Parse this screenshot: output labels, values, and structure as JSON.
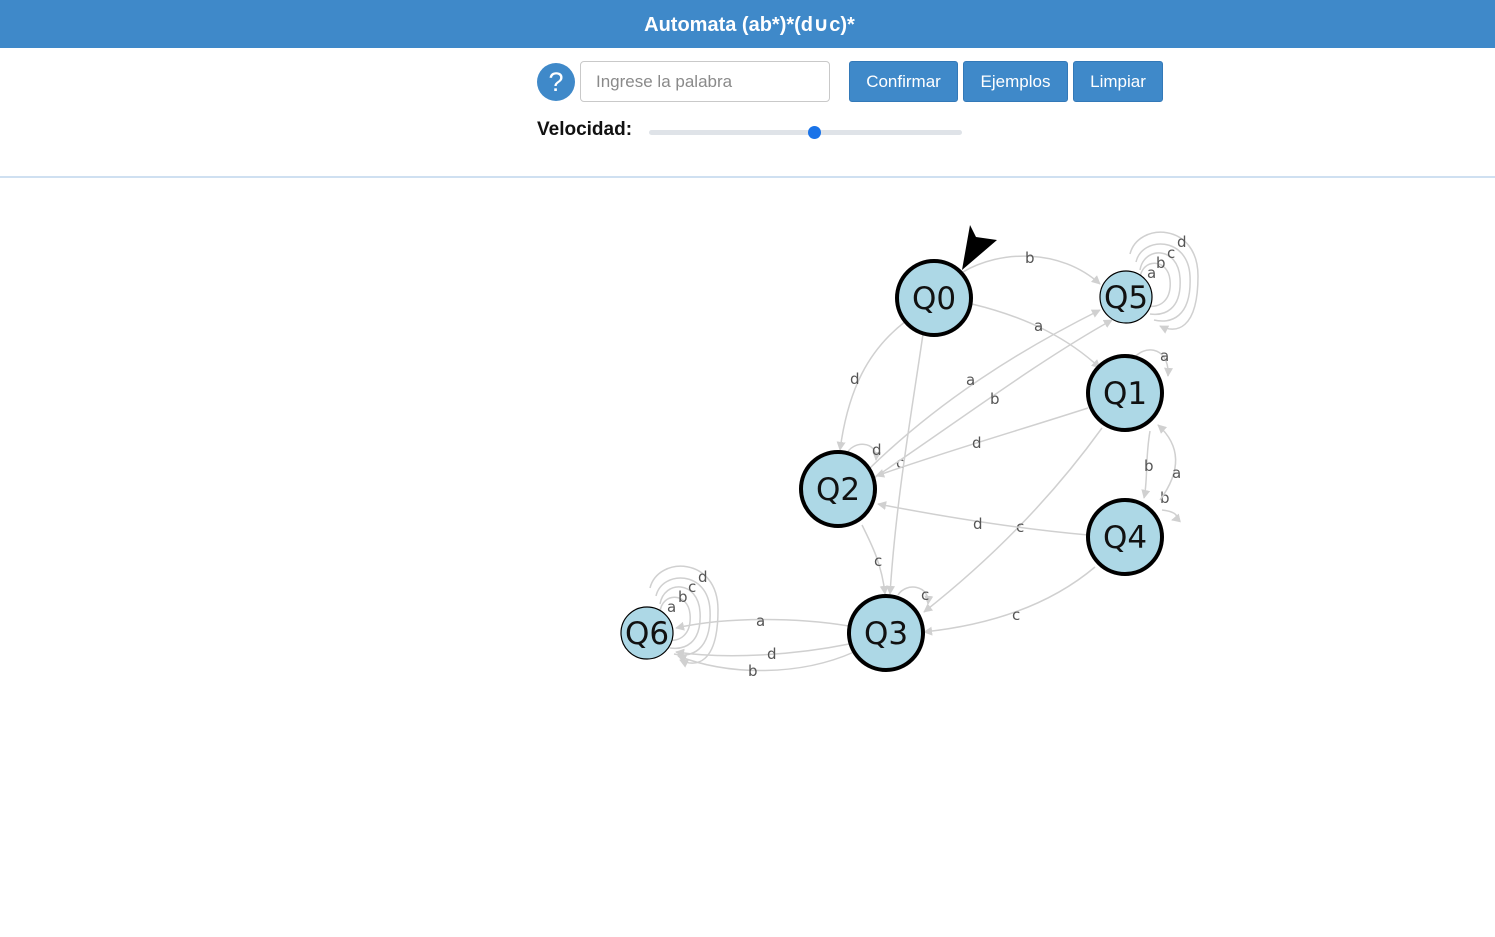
{
  "header": {
    "title": "Automata (ab*)*(d∪c)*"
  },
  "controls": {
    "help_label": "?",
    "input_placeholder": "Ingrese la palabra",
    "input_value": "",
    "confirm_label": "Confirmar",
    "examples_label": "Ejemplos",
    "clear_label": "Limpiar",
    "speed_label": "Velocidad:",
    "speed_value_fraction": 0.53
  },
  "colors": {
    "header_bg": "#3f89c9",
    "button_bg": "#3f89c9",
    "node_fill": "#add8e6",
    "edge_stroke": "#d0d0d0",
    "slider_thumb": "#1a73e8"
  },
  "automaton": {
    "start_state": "Q0",
    "states": [
      {
        "id": "Q0",
        "label": "Q0",
        "accepting": true
      },
      {
        "id": "Q1",
        "label": "Q1",
        "accepting": true
      },
      {
        "id": "Q2",
        "label": "Q2",
        "accepting": true
      },
      {
        "id": "Q3",
        "label": "Q3",
        "accepting": true
      },
      {
        "id": "Q4",
        "label": "Q4",
        "accepting": true
      },
      {
        "id": "Q5",
        "label": "Q5",
        "accepting": false
      },
      {
        "id": "Q6",
        "label": "Q6",
        "accepting": false
      }
    ],
    "transitions": [
      {
        "from": "Q0",
        "to": "Q5",
        "symbol": "b"
      },
      {
        "from": "Q0",
        "to": "Q1",
        "symbol": "a"
      },
      {
        "from": "Q0",
        "to": "Q2",
        "symbol": "d"
      },
      {
        "from": "Q0",
        "to": "Q3",
        "symbol": "c"
      },
      {
        "from": "Q5",
        "to": "Q5",
        "symbol": "a"
      },
      {
        "from": "Q5",
        "to": "Q5",
        "symbol": "b"
      },
      {
        "from": "Q5",
        "to": "Q5",
        "symbol": "c"
      },
      {
        "from": "Q5",
        "to": "Q5",
        "symbol": "d"
      },
      {
        "from": "Q1",
        "to": "Q1",
        "symbol": "a"
      },
      {
        "from": "Q1",
        "to": "Q4",
        "symbol": "b"
      },
      {
        "from": "Q1",
        "to": "Q2",
        "symbol": "d"
      },
      {
        "from": "Q1",
        "to": "Q3",
        "symbol": "c"
      },
      {
        "from": "Q2",
        "to": "Q5",
        "symbol": "a"
      },
      {
        "from": "Q2",
        "to": "Q5",
        "symbol": "b"
      },
      {
        "from": "Q2",
        "to": "Q2",
        "symbol": "d"
      },
      {
        "from": "Q2",
        "to": "Q3",
        "symbol": "c"
      },
      {
        "from": "Q4",
        "to": "Q1",
        "symbol": "a"
      },
      {
        "from": "Q4",
        "to": "Q4",
        "symbol": "b"
      },
      {
        "from": "Q4",
        "to": "Q2",
        "symbol": "d"
      },
      {
        "from": "Q4",
        "to": "Q3",
        "symbol": "c"
      },
      {
        "from": "Q3",
        "to": "Q3",
        "symbol": "c"
      },
      {
        "from": "Q3",
        "to": "Q6",
        "symbol": "a"
      },
      {
        "from": "Q3",
        "to": "Q6",
        "symbol": "d"
      },
      {
        "from": "Q3",
        "to": "Q6",
        "symbol": "b"
      },
      {
        "from": "Q6",
        "to": "Q6",
        "symbol": "a"
      },
      {
        "from": "Q6",
        "to": "Q6",
        "symbol": "b"
      },
      {
        "from": "Q6",
        "to": "Q6",
        "symbol": "c"
      },
      {
        "from": "Q6",
        "to": "Q6",
        "symbol": "d"
      }
    ]
  }
}
